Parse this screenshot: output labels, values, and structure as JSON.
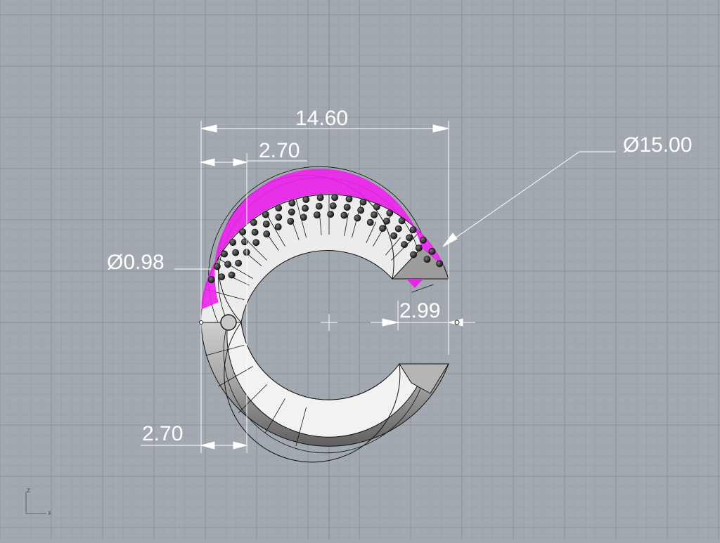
{
  "viewport": {
    "background": "#a3a9b0",
    "grid_minor_color": "#9aa0a7",
    "grid_major_color": "#8b9199",
    "axis_color": "#8a8f96",
    "highlight_color": "#ee22ee"
  },
  "dimensions": {
    "overall_width": "14.60",
    "top_offset": "2.70",
    "bottom_offset": "2.70",
    "outer_diameter": "Ø15.00",
    "stone_diameter": "Ø0.98",
    "gap": "2.99"
  },
  "axes_icon": {
    "z_label": "z",
    "x_label": "x"
  }
}
